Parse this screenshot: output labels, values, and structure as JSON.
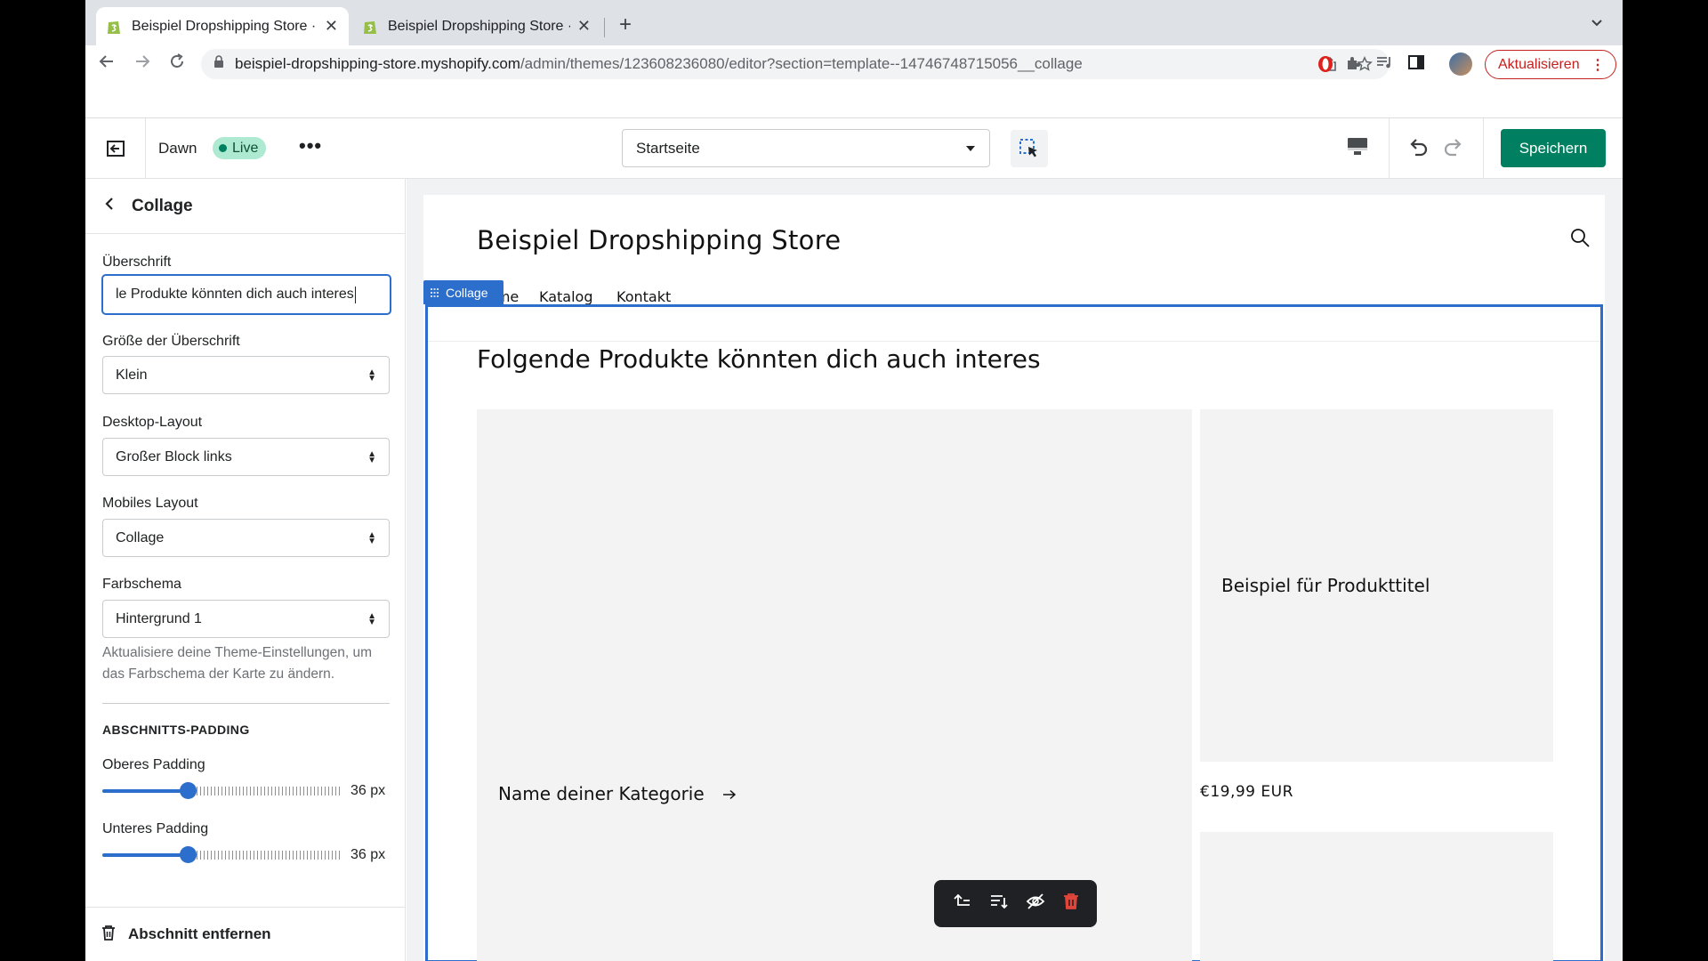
{
  "browser": {
    "tabs": [
      {
        "title": "Beispiel Dropshipping Store · Dawn",
        "active": true
      },
      {
        "title": "Beispiel Dropshipping Store · Bearbeiten",
        "active": false
      }
    ],
    "url_host": "beispiel-dropshipping-store.myshopify.com",
    "url_path": "/admin/themes/123608236080/editor?section=template--14746748715056__collage",
    "update_button": "Aktualisieren"
  },
  "editor": {
    "theme_name": "Dawn",
    "live_badge": "Live",
    "page_select": "Startseite",
    "save_button": "Speichern"
  },
  "panel": {
    "title": "Collage",
    "heading_label": "Überschrift",
    "heading_value": "le Produkte könnten dich auch interes",
    "heading_size_label": "Größe der Überschrift",
    "heading_size_value": "Klein",
    "desktop_layout_label": "Desktop-Layout",
    "desktop_layout_value": "Großer Block links",
    "mobile_layout_label": "Mobiles Layout",
    "mobile_layout_value": "Collage",
    "color_scheme_label": "Farbschema",
    "color_scheme_value": "Hintergrund 1",
    "color_scheme_help": "Aktualisiere deine Theme-Einstellungen, um das Farbschema der Karte zu ändern.",
    "padding_section": "ABSCHNITTS-PADDING",
    "top_padding_label": "Oberes Padding",
    "top_padding_value": "36 px",
    "top_padding_fraction": 0.36,
    "bottom_padding_label": "Unteres Padding",
    "bottom_padding_value": "36 px",
    "bottom_padding_fraction": 0.36,
    "remove_section": "Abschnitt entfernen"
  },
  "preview": {
    "store_name": "Beispiel Dropshipping Store",
    "nav": [
      "Home",
      "Katalog",
      "Kontakt"
    ],
    "section_tag": "Collage",
    "collage_heading": "Folgende Produkte könnten dich auch interes",
    "category_link": "Name deiner Kategorie",
    "product_title": "Beispiel für Produkttitel",
    "product_price": "€19,99 EUR"
  },
  "colors": {
    "accent": "#2c6ecb",
    "save_green": "#008060",
    "live_bg": "#aee9d1",
    "update_red": "#c5221f"
  }
}
